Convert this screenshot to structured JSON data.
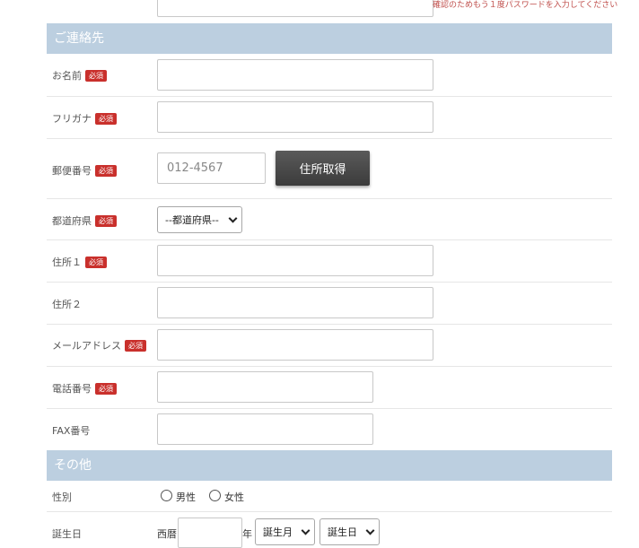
{
  "password_confirm_note": "確認のためもう１度パスワードを入力してください",
  "contact_section": {
    "title": "ご連絡先",
    "required_badge": "必須",
    "name_label": "お名前",
    "furigana_label": "フリガナ",
    "postal_label": "郵便番号",
    "postal_placeholder": "012-4567",
    "address_lookup_button": "住所取得",
    "prefecture_label": "都道府県",
    "prefecture_selected": "--都道府県--",
    "address1_label": "住所１",
    "address2_label": "住所２",
    "email_label": "メールアドレス",
    "phone_label": "電話番号",
    "fax_label": "FAX番号"
  },
  "other_section": {
    "title": "その他",
    "gender_label": "性別",
    "gender_male": "男性",
    "gender_female": "女性",
    "birthday_label": "誕生日",
    "era_label": "西暦",
    "year_suffix": "年",
    "month_selected": "誕生月",
    "day_selected": "誕生日"
  },
  "colors": {
    "section_header_bg": "#bccfe0",
    "required_badge": "#c9302c",
    "note_text": "#c0504d",
    "button_bg": "#4a4a4a"
  }
}
